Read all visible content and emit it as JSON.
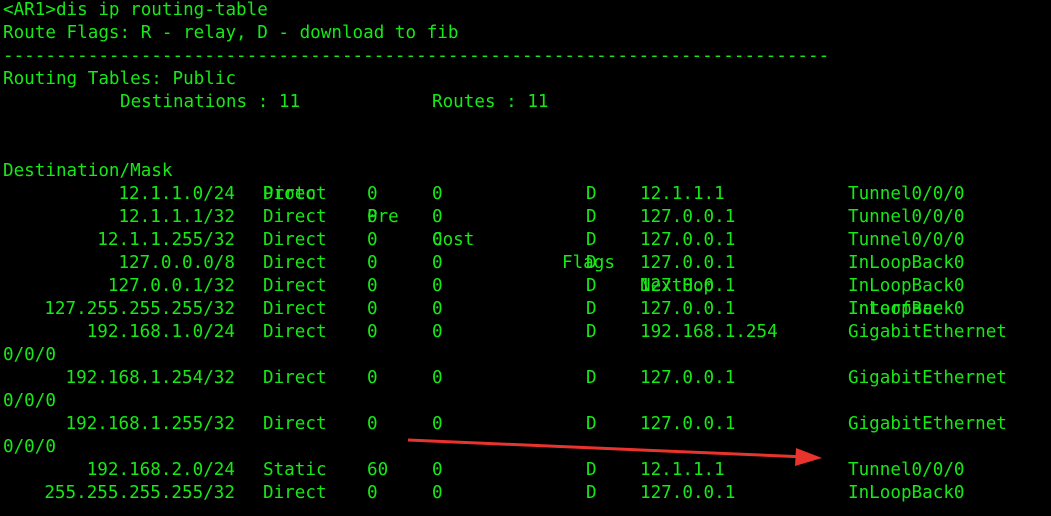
{
  "terminal": {
    "prompt_line": "<AR1>dis ip routing-table",
    "flags_legend": "Route Flags: R - relay, D - download to fib",
    "separator": "------------------------------------------------------------------------------",
    "tables_title": "Routing Tables: Public",
    "summary_destinations": "Destinations : 11",
    "summary_routes": "Routes : 11",
    "headers": {
      "destination": "Destination/Mask",
      "proto": "Proto",
      "pre": "Pre",
      "cost": "Cost",
      "flags": "Flags",
      "nexthop": "NextHop",
      "interface": "Interface"
    },
    "routes": [
      {
        "destination": "12.1.1.0/24",
        "proto": "Direct",
        "pre": "0",
        "cost": "0",
        "flags": "D",
        "nexthop": "12.1.1.1",
        "interface": "Tunnel0/0/0",
        "interface_wrap": ""
      },
      {
        "destination": "12.1.1.1/32",
        "proto": "Direct",
        "pre": "0",
        "cost": "0",
        "flags": "D",
        "nexthop": "127.0.0.1",
        "interface": "Tunnel0/0/0",
        "interface_wrap": ""
      },
      {
        "destination": "12.1.1.255/32",
        "proto": "Direct",
        "pre": "0",
        "cost": "0",
        "flags": "D",
        "nexthop": "127.0.0.1",
        "interface": "Tunnel0/0/0",
        "interface_wrap": ""
      },
      {
        "destination": "127.0.0.0/8",
        "proto": "Direct",
        "pre": "0",
        "cost": "0",
        "flags": "D",
        "nexthop": "127.0.0.1",
        "interface": "InLoopBack0",
        "interface_wrap": ""
      },
      {
        "destination": "127.0.0.1/32",
        "proto": "Direct",
        "pre": "0",
        "cost": "0",
        "flags": "D",
        "nexthop": "127.0.0.1",
        "interface": "InLoopBack0",
        "interface_wrap": ""
      },
      {
        "destination": "127.255.255.255/32",
        "proto": "Direct",
        "pre": "0",
        "cost": "0",
        "flags": "D",
        "nexthop": "127.0.0.1",
        "interface": "InLoopBack0",
        "interface_wrap": ""
      },
      {
        "destination": "192.168.1.0/24",
        "proto": "Direct",
        "pre": "0",
        "cost": "0",
        "flags": "D",
        "nexthop": "192.168.1.254",
        "interface": "GigabitEthernet",
        "interface_wrap": "0/0/0"
      },
      {
        "destination": "192.168.1.254/32",
        "proto": "Direct",
        "pre": "0",
        "cost": "0",
        "flags": "D",
        "nexthop": "127.0.0.1",
        "interface": "GigabitEthernet",
        "interface_wrap": "0/0/0"
      },
      {
        "destination": "192.168.1.255/32",
        "proto": "Direct",
        "pre": "0",
        "cost": "0",
        "flags": "D",
        "nexthop": "127.0.0.1",
        "interface": "GigabitEthernet",
        "interface_wrap": "0/0/0"
      },
      {
        "destination": "192.168.2.0/24",
        "proto": "Static",
        "pre": "60",
        "cost": "0",
        "flags": "D",
        "nexthop": "12.1.1.1",
        "interface": "Tunnel0/0/0",
        "interface_wrap": ""
      },
      {
        "destination": "255.255.255.255/32",
        "proto": "Direct",
        "pre": "0",
        "cost": "0",
        "flags": "D",
        "nexthop": "127.0.0.1",
        "interface": "InLoopBack0",
        "interface_wrap": ""
      }
    ]
  },
  "colors": {
    "background": "#000000",
    "text": "#17e817",
    "annotation_arrow": "#e8342c"
  }
}
